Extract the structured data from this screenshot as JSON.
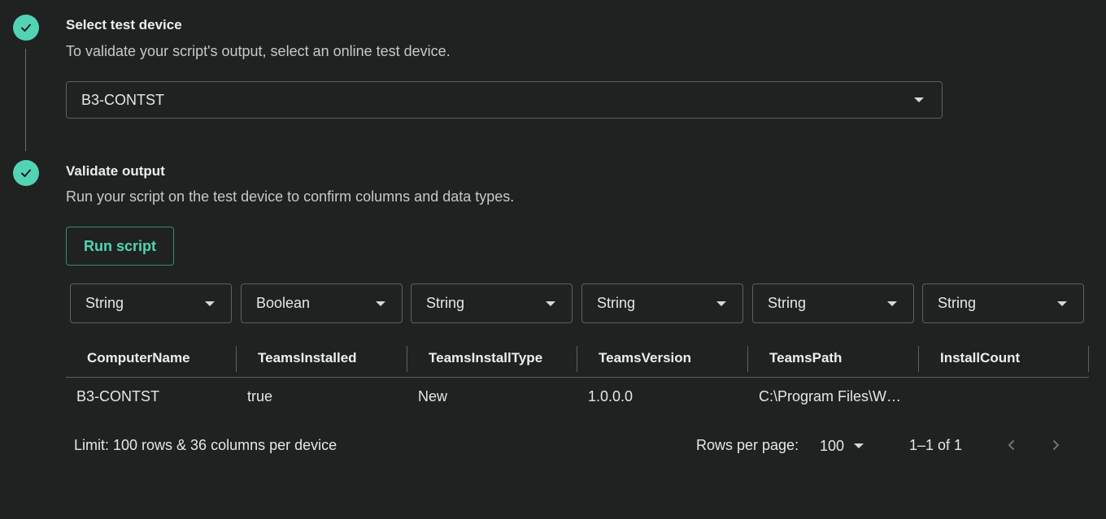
{
  "steps": [
    {
      "title": "Select test device",
      "description": "To validate your script's output, select an online test device."
    },
    {
      "title": "Validate output",
      "description": "Run your script on the test device to confirm columns and data types."
    }
  ],
  "device_select": {
    "value": "B3-CONTST"
  },
  "run_button": {
    "label": "Run script"
  },
  "column_types": [
    "String",
    "Boolean",
    "String",
    "String",
    "String",
    "String"
  ],
  "table": {
    "columns": [
      "ComputerName",
      "TeamsInstalled",
      "TeamsInstallType",
      "TeamsVersion",
      "TeamsPath",
      "InstallCount"
    ],
    "rows": [
      [
        "B3-CONTST",
        "true",
        "New",
        "1.0.0.0",
        "C:\\Program Files\\W…",
        ""
      ]
    ]
  },
  "footer": {
    "limit_text": "Limit: 100 rows & 36 columns per device",
    "rows_per_page_label": "Rows per page:",
    "rows_per_page_value": "100",
    "range_text": "1–1 of 1"
  },
  "colors": {
    "accent": "#52d4b4",
    "background": "#202222",
    "border": "#5c6060"
  },
  "icons": {
    "step_complete": "check-icon",
    "dropdown": "chevron-down-icon",
    "prev_page": "chevron-left-icon",
    "next_page": "chevron-right-icon"
  }
}
